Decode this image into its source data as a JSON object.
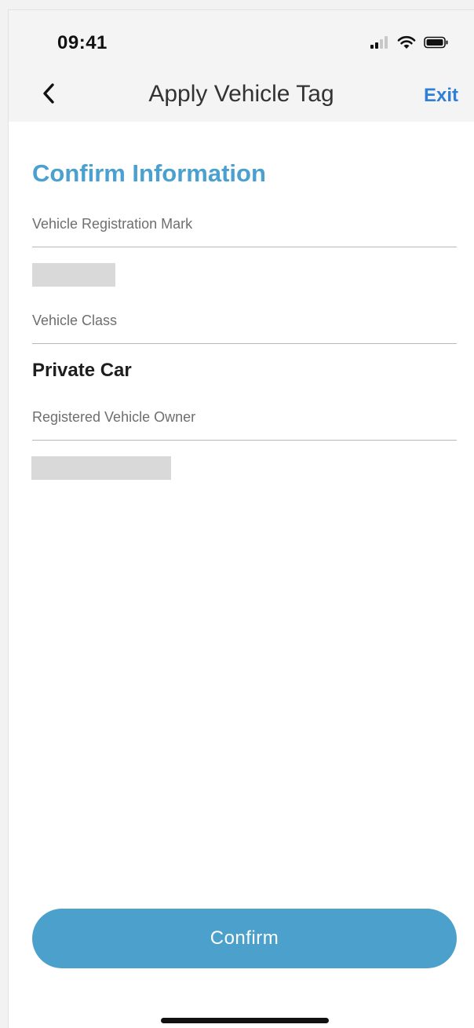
{
  "status_bar": {
    "time": "09:41",
    "icons": [
      "cellular-signal-icon",
      "wifi-icon",
      "battery-icon"
    ]
  },
  "nav": {
    "back_icon": "chevron-left-icon",
    "title": "Apply Vehicle Tag",
    "exit_label": "Exit"
  },
  "form": {
    "heading": "Confirm Information",
    "fields": [
      {
        "label": "Vehicle Registration Mark",
        "value": "",
        "redacted": true
      },
      {
        "label": "Vehicle Class",
        "value": "Private Car",
        "redacted": false
      },
      {
        "label": "Registered Vehicle Owner",
        "value": "",
        "redacted": true
      }
    ]
  },
  "actions": {
    "confirm_label": "Confirm"
  },
  "colors": {
    "accent": "#4ba1cc",
    "heading": "#4aa0cf",
    "link": "#2f7fd8",
    "redaction": "#d9d9d9"
  }
}
